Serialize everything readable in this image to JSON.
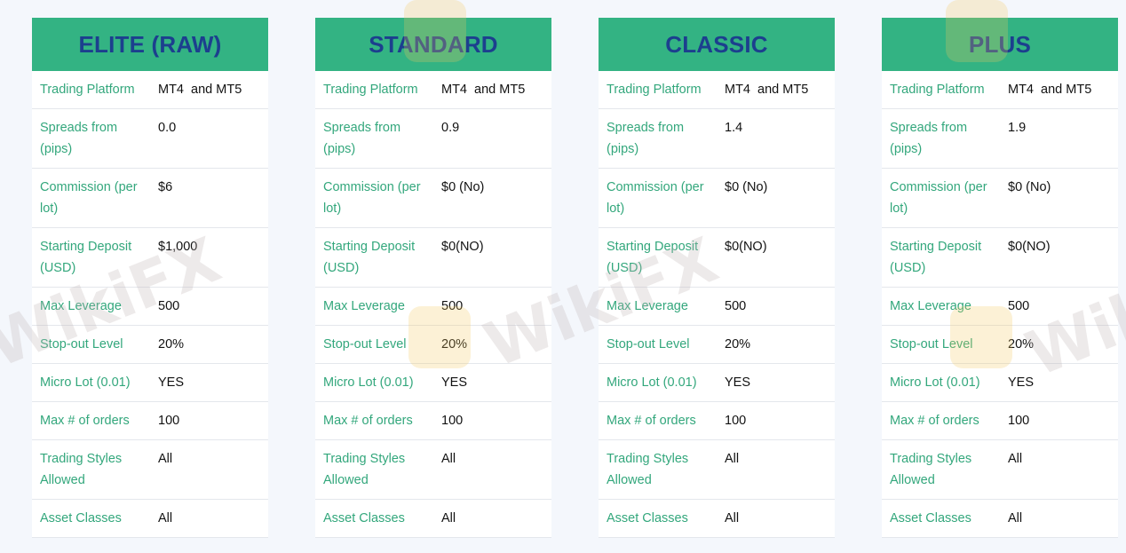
{
  "cards": [
    {
      "title": "ELITE (RAW)",
      "rows": [
        {
          "label": "Trading Platform",
          "value": "MT4  and MT5"
        },
        {
          "label": "Spreads from (pips)",
          "value": "0.0"
        },
        {
          "label": "Commission (per lot)",
          "value": "$6"
        },
        {
          "label": "Starting Deposit (USD)",
          "value": "$1,000"
        },
        {
          "label": "Max Leverage",
          "value": "500"
        },
        {
          "label": "Stop-out Level",
          "value": "20%"
        },
        {
          "label": "Micro Lot (0.01)",
          "value": "YES"
        },
        {
          "label": "Max # of orders",
          "value": "100"
        },
        {
          "label": "Trading Styles Allowed",
          "value": "All"
        },
        {
          "label": "Asset Classes",
          "value": "All"
        }
      ]
    },
    {
      "title": "STANDARD",
      "rows": [
        {
          "label": "Trading Platform",
          "value": "MT4  and MT5"
        },
        {
          "label": "Spreads from (pips)",
          "value": "0.9"
        },
        {
          "label": "Commission (per lot)",
          "value": "$0 (No)"
        },
        {
          "label": "Starting Deposit (USD)",
          "value": "$0(NO)"
        },
        {
          "label": "Max Leverage",
          "value": "500"
        },
        {
          "label": "Stop-out Level",
          "value": "20%"
        },
        {
          "label": "Micro Lot (0.01)",
          "value": "YES"
        },
        {
          "label": "Max # of orders",
          "value": "100"
        },
        {
          "label": "Trading Styles Allowed",
          "value": "All"
        },
        {
          "label": "Asset Classes",
          "value": "All"
        }
      ]
    },
    {
      "title": "CLASSIC",
      "rows": [
        {
          "label": "Trading Platform",
          "value": "MT4  and MT5"
        },
        {
          "label": "Spreads from (pips)",
          "value": "1.4"
        },
        {
          "label": "Commission (per lot)",
          "value": "$0 (No)"
        },
        {
          "label": "Starting Deposit (USD)",
          "value": "$0(NO)"
        },
        {
          "label": "Max Leverage",
          "value": "500"
        },
        {
          "label": "Stop-out Level",
          "value": "20%"
        },
        {
          "label": "Micro Lot (0.01)",
          "value": "YES"
        },
        {
          "label": "Max # of orders",
          "value": "100"
        },
        {
          "label": "Trading Styles Allowed",
          "value": "All"
        },
        {
          "label": "Asset Classes",
          "value": "All"
        }
      ]
    },
    {
      "title": "PLUS",
      "rows": [
        {
          "label": "Trading Platform",
          "value": "MT4  and MT5"
        },
        {
          "label": "Spreads from (pips)",
          "value": "1.9"
        },
        {
          "label": "Commission (per lot)",
          "value": "$0 (No)"
        },
        {
          "label": "Starting Deposit (USD)",
          "value": "$0(NO)"
        },
        {
          "label": "Max Leverage",
          "value": "500"
        },
        {
          "label": "Stop-out Level",
          "value": "20%"
        },
        {
          "label": "Micro Lot (0.01)",
          "value": "YES"
        },
        {
          "label": "Max # of orders",
          "value": "100"
        },
        {
          "label": "Trading Styles Allowed",
          "value": "All"
        },
        {
          "label": "Asset Classes",
          "value": "All"
        }
      ]
    }
  ],
  "watermark": {
    "text": "WikiFX"
  },
  "colors": {
    "header_bg": "#33b383",
    "header_text": "#1c3f8e",
    "label_text": "#33a77c",
    "page_bg": "#f4f7fc"
  }
}
